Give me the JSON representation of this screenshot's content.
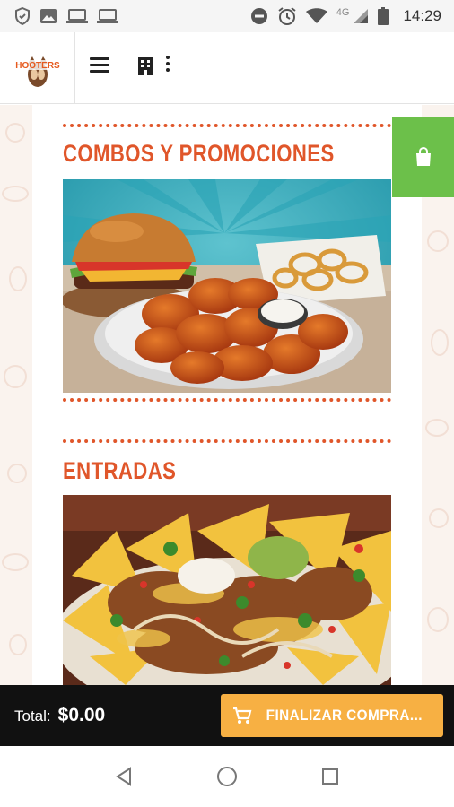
{
  "status_bar": {
    "time": "14:29",
    "network": "4G",
    "left_icons": [
      "shield-icon",
      "image-icon",
      "laptop-icon",
      "laptop-icon"
    ],
    "right_icons": [
      "do-not-disturb-icon",
      "alarm-icon",
      "wifi-icon",
      "signal-icon",
      "battery-icon"
    ]
  },
  "header": {
    "logo_text": "HOOTERS",
    "menu_icon": "hamburger-icon",
    "store_icon": "building-icon",
    "more_icon": "kebab-icon"
  },
  "sections": [
    {
      "title": "COMBOS Y PROMOCIONES",
      "image": "wings-burger-onion-rings-photo"
    },
    {
      "title": "ENTRADAS",
      "image": "nachos-photo"
    }
  ],
  "cart": {
    "icon": "shopping-bag-icon"
  },
  "footer": {
    "total_label": "Total:",
    "total_value": "$0.00",
    "checkout_label": "FINALIZAR COMPRA...",
    "checkout_icon": "cart-icon"
  },
  "colors": {
    "accent": "#e0562a",
    "cart_green": "#6cc04a",
    "checkout_orange": "#f7b043",
    "footer_bg": "#111111"
  }
}
